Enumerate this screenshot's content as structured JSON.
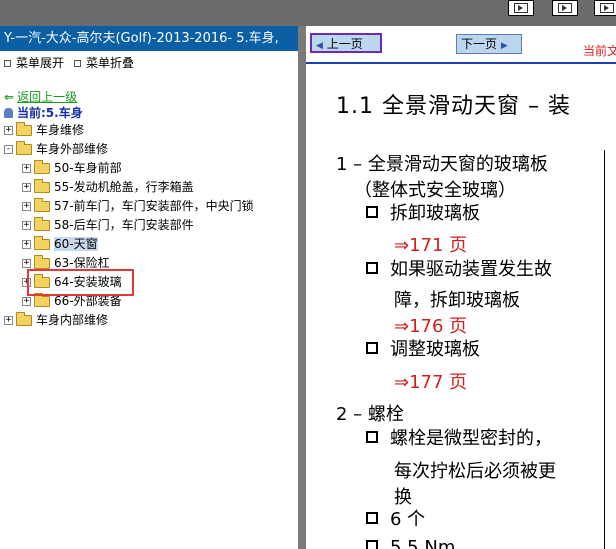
{
  "left_panel": {
    "title": "Y-一汽-大众-高尔夫(Golf)-2013-2016- 5.车身,",
    "expand_label": "菜单展开",
    "collapse_label": "菜单折叠",
    "back_label": "返回上一级",
    "current_label": "当前:5.车身",
    "tree": [
      {
        "label": "车身维修",
        "level": 0,
        "toggle": "+"
      },
      {
        "label": "车身外部维修",
        "level": 0,
        "toggle": "-"
      },
      {
        "label": "50-车身前部",
        "level": 1,
        "toggle": "+"
      },
      {
        "label": "55-发动机舱盖，行李箱盖",
        "level": 1,
        "toggle": "+"
      },
      {
        "label": "57-前车门，车门安装部件，中央门锁",
        "level": 1,
        "toggle": "+"
      },
      {
        "label": "58-后车门，车门安装部件",
        "level": 1,
        "toggle": "+"
      },
      {
        "label": "60-天窗",
        "level": 1,
        "toggle": "+",
        "selected": true
      },
      {
        "label": "63-保险杠",
        "level": 1,
        "toggle": "+"
      },
      {
        "label": "64-安装玻璃",
        "level": 1,
        "toggle": "+"
      },
      {
        "label": "66-外部装备",
        "level": 1,
        "toggle": "+"
      },
      {
        "label": "车身内部维修",
        "level": 0,
        "toggle": "+"
      }
    ]
  },
  "nav": {
    "prev_label": "上一页",
    "next_label": "下一页",
    "note": "当前文"
  },
  "document": {
    "heading": "1.1  全景滑动天窗 – 装",
    "section1_line1": "1 – 全景滑动天窗的玻璃板",
    "section1_line2": "（整体式安全玻璃）",
    "item1": "拆卸玻璃板",
    "item1_ref": "⇒171 页",
    "item2_line1": "如果驱动装置发生故",
    "item2_line2": "障，拆卸玻璃板",
    "item2_ref": "⇒176 页",
    "item3": "调整玻璃板",
    "item3_ref": "⇒177 页",
    "section2": "2 – 螺栓",
    "item4_line1": "螺栓是微型密封的，",
    "item4_line2": "每次拧松后必须被更",
    "item4_line3": "换",
    "item5": "6 个",
    "item6": "5.5 Nm"
  },
  "colors": {
    "title_bar": "#0a5fa5",
    "link_green": "#1a9a1a",
    "current_blue": "#1530a6",
    "ref_red": "#d21f1f",
    "highlight_box": "#e23a3a"
  }
}
